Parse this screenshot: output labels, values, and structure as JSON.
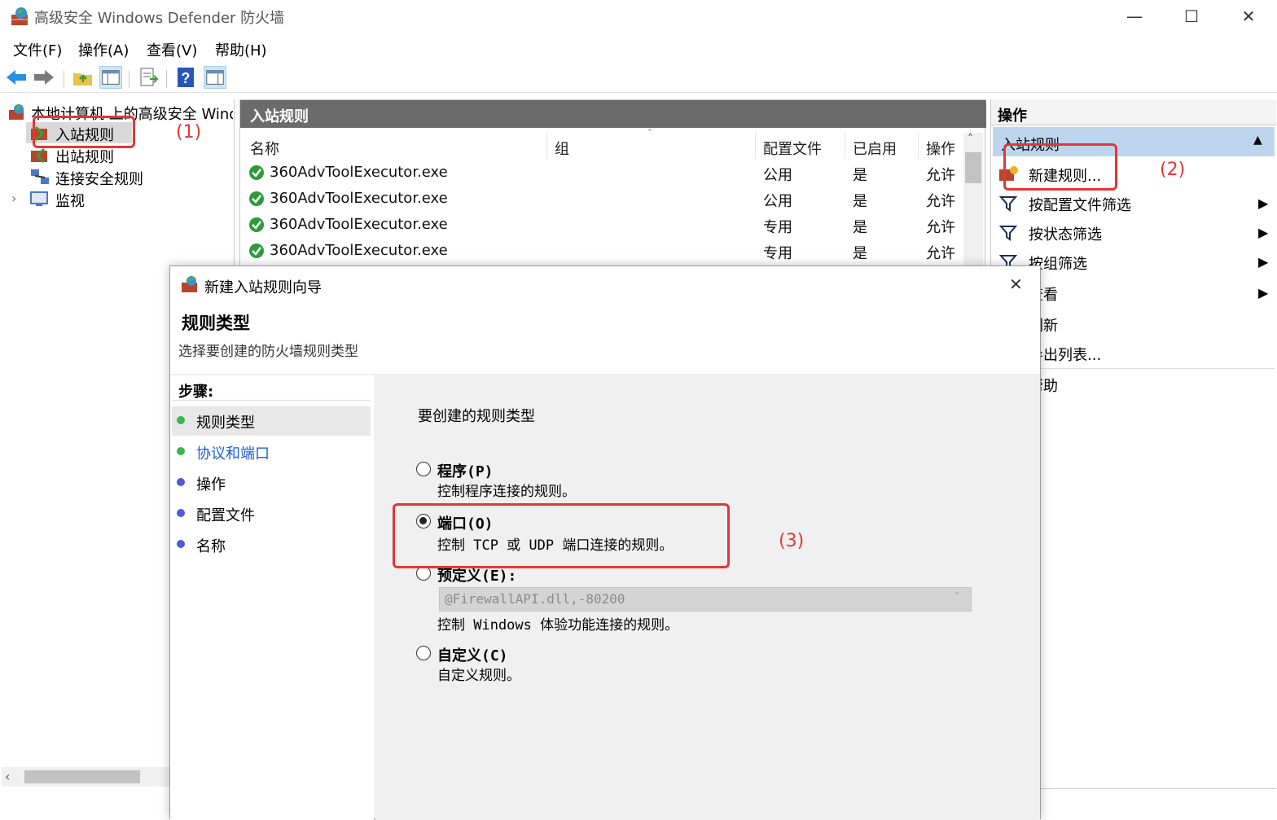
{
  "window": {
    "title": "高级安全 Windows Defender 防火墙",
    "min_glyph": "—",
    "max_glyph": "☐",
    "close_glyph": "✕"
  },
  "menu": [
    "文件(F)",
    "操作(A)",
    "查看(V)",
    "帮助(H)"
  ],
  "tree": {
    "root": "本地计算机 上的高级安全 Windows",
    "items": [
      "入站规则",
      "出站规则",
      "连接安全规则",
      "监视"
    ]
  },
  "center": {
    "header": "入站规则",
    "columns": [
      "名称",
      "组",
      "配置文件",
      "已启用",
      "操作"
    ],
    "rows": [
      {
        "name": "360AdvToolExecutor.exe",
        "group": "",
        "profile": "公用",
        "enabled": "是",
        "action": "允许"
      },
      {
        "name": "360AdvToolExecutor.exe",
        "group": "",
        "profile": "公用",
        "enabled": "是",
        "action": "允许"
      },
      {
        "name": "360AdvToolExecutor.exe",
        "group": "",
        "profile": "专用",
        "enabled": "是",
        "action": "允许"
      },
      {
        "name": "360AdvToolExecutor.exe",
        "group": "",
        "profile": "专用",
        "enabled": "是",
        "action": "允许"
      }
    ]
  },
  "actions": {
    "header": "操作",
    "section": "入站规则",
    "items": [
      "新建规则...",
      "按配置文件筛选",
      "按状态筛选",
      "按组筛选",
      "查看",
      "刷新",
      "导出列表...",
      "帮助"
    ]
  },
  "dialog": {
    "title": "新建入站规则向导",
    "heading": "规则类型",
    "subheading": "选择要创建的防火墙规则类型",
    "steps_label": "步骤:",
    "steps": [
      "规则类型",
      "协议和端口",
      "操作",
      "配置文件",
      "名称"
    ],
    "prompt": "要创建的规则类型",
    "options": [
      {
        "label": "程序(P)",
        "desc": "控制程序连接的规则。"
      },
      {
        "label": "端口(O)",
        "desc": "控制 TCP 或 UDP 端口连接的规则。"
      },
      {
        "label": "预定义(E):",
        "desc": "控制 Windows 体验功能连接的规则。"
      },
      {
        "label": "自定义(C)",
        "desc": "自定义规则。"
      }
    ],
    "predefined_value": "@FirewallAPI.dll,-80200",
    "selected": "端口(O)"
  },
  "annotations": [
    "(1)",
    "(2)",
    "(3)"
  ],
  "colors": {
    "annotation_red": "#e63535",
    "step_done": "#3cb54a",
    "step_todo": "#4f5bd5",
    "link_blue": "#1a5fd1"
  }
}
